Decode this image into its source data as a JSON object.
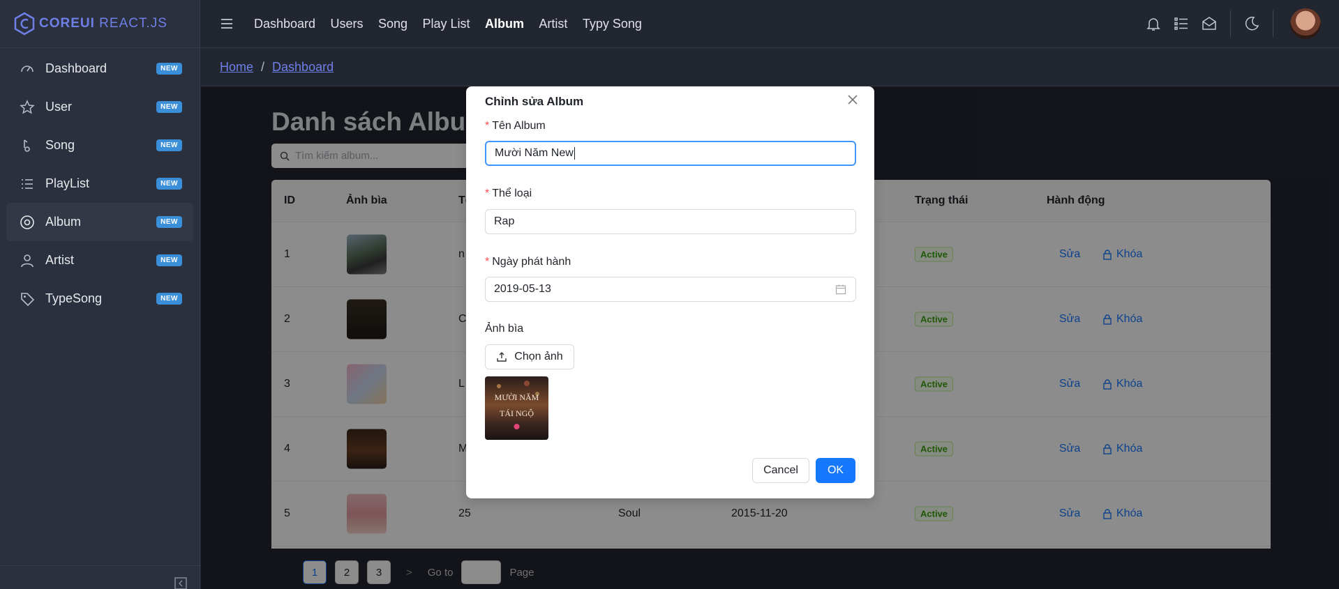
{
  "brand": {
    "logo_bold": "COREUI",
    "logo_light": " REACT.JS"
  },
  "sidebar": {
    "items": [
      {
        "label": "Dashboard",
        "badge": "NEW",
        "icon": "speedometer-icon"
      },
      {
        "label": "User",
        "badge": "NEW",
        "icon": "star-icon"
      },
      {
        "label": "Song",
        "badge": "NEW",
        "icon": "music-note-icon"
      },
      {
        "label": "PlayList",
        "badge": "NEW",
        "icon": "list-icon"
      },
      {
        "label": "Album",
        "badge": "NEW",
        "icon": "disc-icon",
        "active": true
      },
      {
        "label": "Artist",
        "badge": "NEW",
        "icon": "user-icon"
      },
      {
        "label": "TypeSong",
        "badge": "NEW",
        "icon": "tag-icon"
      }
    ]
  },
  "header": {
    "nav": [
      "Dashboard",
      "Users",
      "Song",
      "Play List",
      "Album",
      "Artist",
      "Typy Song"
    ],
    "active": "Album"
  },
  "breadcrumb": {
    "home": "Home",
    "separator": "/",
    "current": "Dashboard"
  },
  "main": {
    "title": "Danh sách Album",
    "search_placeholder": "Tìm kiếm album...",
    "columns": [
      "ID",
      "Ảnh bìa",
      "Tên",
      "",
      "",
      "Trạng thái",
      "Hành động"
    ],
    "rows": [
      {
        "id": "1",
        "name": "n",
        "genre": "",
        "date": "",
        "status": "Active",
        "edit": "Sửa",
        "lock": "Khóa"
      },
      {
        "id": "2",
        "name": "C",
        "genre": "",
        "date": "",
        "status": "Active",
        "edit": "Sửa",
        "lock": "Khóa"
      },
      {
        "id": "3",
        "name": "L",
        "genre": "",
        "date": "",
        "status": "Active",
        "edit": "Sửa",
        "lock": "Khóa"
      },
      {
        "id": "4",
        "name": "M",
        "genre": "",
        "date": "",
        "status": "Active",
        "edit": "Sửa",
        "lock": "Khóa"
      },
      {
        "id": "5",
        "name": "25",
        "genre": "Soul",
        "date": "2015-11-20",
        "status": "Active",
        "edit": "Sửa",
        "lock": "Khóa"
      }
    ],
    "pagination": {
      "pages": [
        "1",
        "2",
        "3"
      ],
      "current": "1",
      "next": ">",
      "goto_label": "Go to",
      "page_label": "Page"
    }
  },
  "modal": {
    "title": "Chỉnh sửa Album",
    "fields": {
      "name_label": "Tên Album",
      "name_value": "Mười Năm New",
      "genre_label": "Thể loại",
      "genre_value": "Rap",
      "date_label": "Ngày phát hành",
      "date_value": "2019-05-13",
      "cover_label": "Ảnh bìa",
      "upload_label": "Chọn ảnh",
      "preview_text_line1": "MƯỜI NĂM",
      "preview_text_line2": "TÁI NGỘ"
    },
    "required_mark": "*",
    "cancel": "Cancel",
    "ok": "OK"
  },
  "colors": {
    "accent": "#1677ff",
    "sidebar_bg": "#2a303d",
    "badge": "#3b8fd9",
    "brand": "#6f7fe8"
  }
}
